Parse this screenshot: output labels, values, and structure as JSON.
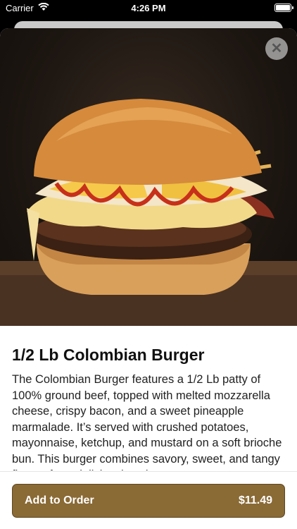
{
  "status_bar": {
    "carrier": "Carrier",
    "time": "4:26 PM"
  },
  "item": {
    "title": "1/2 Lb Colombian Burger",
    "description": "The Colombian Burger features a 1/2 Lb patty of 100% ground beef, topped with melted mozzarella cheese, crispy bacon, and a sweet pineapple marmalade. It’s served with crushed potatoes, mayonnaise, ketchup, and mustard on a soft brioche bun. This burger combines savory, sweet, and tangy flavors for a deliciously unique"
  },
  "order_button": {
    "label": "Add to Order",
    "price": "$11.49"
  },
  "colors": {
    "accent": "#8a6a35"
  },
  "icons": {
    "close": "close-icon",
    "wifi": "wifi-icon",
    "battery": "battery-icon"
  }
}
